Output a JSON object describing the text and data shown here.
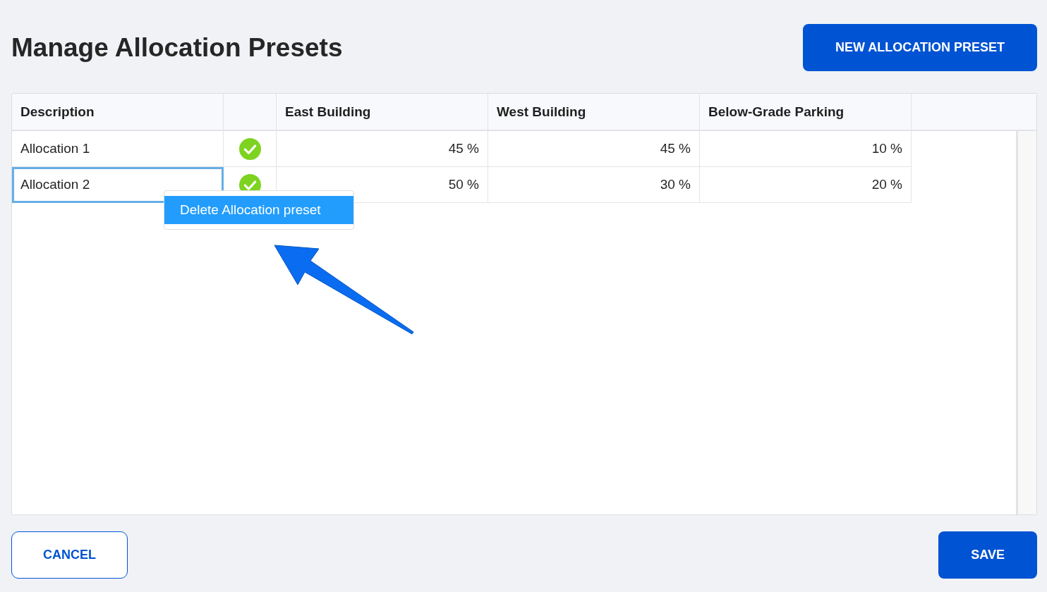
{
  "title": "Manage Allocation Presets",
  "new_button": "NEW ALLOCATION PRESET",
  "table": {
    "columns": [
      "Description",
      "East Building",
      "West Building",
      "Below-Grade Parking"
    ],
    "rows": [
      {
        "description": "Allocation 1",
        "approved": true,
        "selected": false,
        "values": [
          "45 %",
          "45 %",
          "10 %"
        ]
      },
      {
        "description": "Allocation 2",
        "approved": true,
        "selected": true,
        "values": [
          "50 %",
          "30 %",
          "20 %"
        ]
      }
    ]
  },
  "context_menu": {
    "items": [
      {
        "label": "Delete Allocation preset",
        "selected": true
      }
    ]
  },
  "cancel_button": "CANCEL",
  "save_button": "SAVE"
}
